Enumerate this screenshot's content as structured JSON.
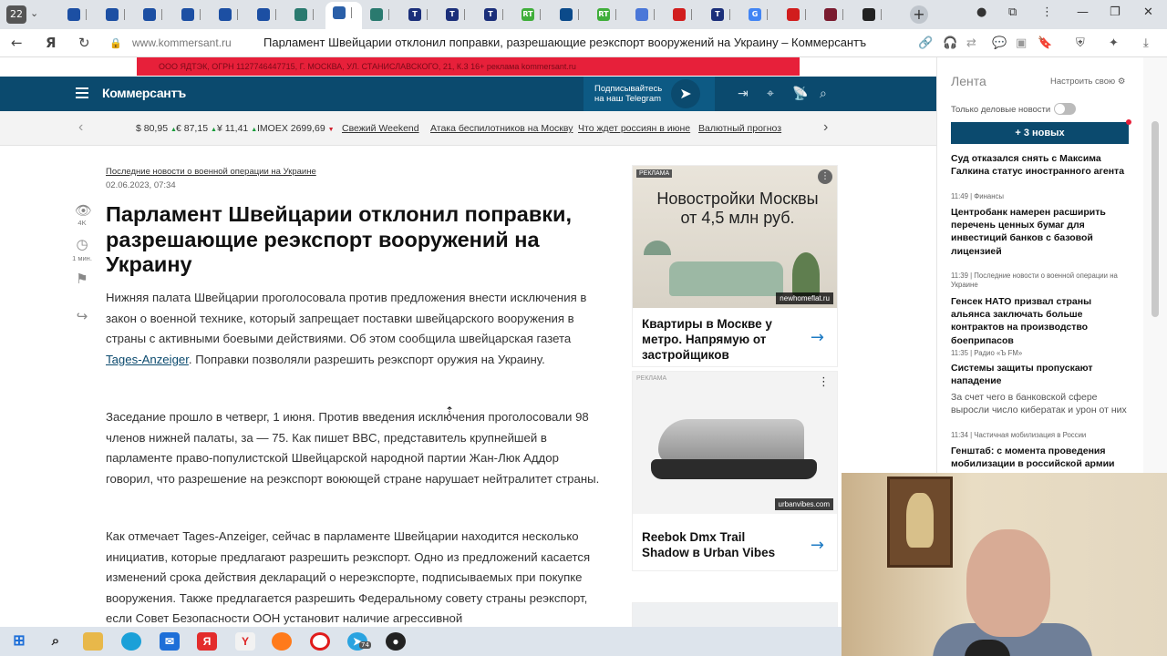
{
  "browser": {
    "tab_count": "22",
    "site_host": "www.kommersant.ru",
    "page_title": "Парламент Швейцарии отклонил поправки, разрешающие реэкспорт вооружений на Украину – Коммерсантъ",
    "tab_favicon_colors": [
      "#1c4fa3",
      "#1c4fa3",
      "#1c4fa3",
      "#1c4fa3",
      "#1c4fa3",
      "#1c4fa3",
      "#2a7a6f",
      "#2a5fa8",
      "#2a7a6f",
      "#1b2f7a",
      "#1b2f7a",
      "#1b2f7a",
      "#3fae3a",
      "#0b4a8a",
      "#3fae3a",
      "#4a77d8",
      "#d11d1d",
      "#1b2f7a",
      "#4285f4",
      "#d11d1d",
      "#7a1b2f",
      "#222222"
    ],
    "tab_letters": [
      "",
      "",
      "",
      "",
      "",
      "",
      "",
      "",
      "",
      "T",
      "T",
      "T",
      "RT",
      "",
      "RT",
      "",
      "",
      "T",
      "G",
      "",
      "",
      ""
    ],
    "active_tab_index": 7
  },
  "site": {
    "ad_strip_text": "ООО ЯДТЭК, ОГРН 1127746447715, Г. МОСКВА, УЛ. СТАНИСЛАВСКОГО, 21, К.3        16+  реклама  kommersant.ru",
    "logo": "Коммерсантъ",
    "telegram_text_1": "Подписывайтесь",
    "telegram_text_2": "на наш Telegram"
  },
  "ticker": {
    "usd": "$ 80,95",
    "eur": "€ 87,15",
    "cny": "¥ 11,41",
    "imoex": "IMOEX 2699,69",
    "links": [
      "Свежий Weekend",
      "Атака беспилотников на Москву",
      "Что ждет россиян в июне",
      "Валютный прогноз"
    ]
  },
  "article": {
    "rubric": "Последние новости о военной операции на Украине",
    "date": "02.06.2023, 07:34",
    "views": "4K",
    "read_time": "1 мин.",
    "title": "Парламент Швейцарии отклонил поправки, разрешающие реэкспорт вооружений на Украину",
    "p1_a": "Нижняя палата Швейцарии проголосовала против предложения внести исключения в закон о военной технике, который запрещает поставки швейцарского вооружения в страны с активными боевыми действиями. Об этом сообщила швейцарская газета ",
    "p1_link": "Tages-Anzeiger",
    "p1_b": ". Поправки позволяли разрешить реэкспорт оружия на Украину.",
    "p2": "Заседание прошло в четверг, 1 июня. Против введения исключения проголосовали 98 членов нижней палаты, за — 75. Как пишет BBC, представитель крупнейшей в парламенте право-популистской Швейцарской народной партии Жан-Люк Аддор говорил, что разрешение на реэкспорт воюющей стране нарушает нейтралитет страны.",
    "p3": "Как отмечает Tages-Anzeiger, сейчас в парламенте Швейцарии находится несколько инициатив, которые предлагают разрешить реэкспорт. Одно из предложений касается изменений срока действия деклараций о нереэкспорте, подписываемых при покупке вооружения. Также предлагается разрешить Федеральному совету страны реэкспорт, если Совет Безопасности ООН установит наличие агрессивной"
  },
  "ads": {
    "label": "РЕКЛАМА",
    "ad1_headline": "Новостройки Москвы от 4,5 млн руб.",
    "ad1_brand": "newhomeflat.ru",
    "ad1_caption": "Квартиры в Москве у метро. Напрямую от застройщиков",
    "ad2_label": "РЕКЛАМА",
    "ad2_brand": "urbanvibes.com",
    "ad2_caption": "Reebok Dmx Trail Shadow в Urban Vibes"
  },
  "feed": {
    "title": "Лента",
    "configure": "Настроить свою",
    "business_only": "Только деловые новости",
    "new_button": "+ 3 новых",
    "items": [
      {
        "meta": "",
        "text": "Суд отказался снять с Максима Галкина статус иностранного агента",
        "sub": ""
      },
      {
        "meta": "11:49  |  Финансы",
        "text": "Центробанк намерен расширить перечень ценных бумаг для инвестиций банков с базовой лицензией",
        "sub": ""
      },
      {
        "meta": "11:39  |  Последние новости о военной операции на Украине",
        "text": "Генсек НАТО призвал страны альянса заключать больше контрактов на производство боеприпасов",
        "sub": ""
      },
      {
        "meta": "11:35  |  Радио «Ъ FM»",
        "text": "Системы защиты пропускают нападение",
        "sub": "За счет чего в банковской сфере выросли число кибератак и урон от них"
      },
      {
        "meta": "11:34  |  Частичная мобилизация в России",
        "text": "Генштаб: с момента проведения мобилизации в российской армии",
        "sub": ""
      }
    ]
  },
  "taskbar": {
    "apps": [
      "windows-start",
      "search",
      "file-explorer",
      "edge",
      "mail",
      "yandex",
      "yandex-browser",
      "firefox",
      "opera",
      "telegram",
      "obs"
    ],
    "telegram_badge": "74"
  }
}
